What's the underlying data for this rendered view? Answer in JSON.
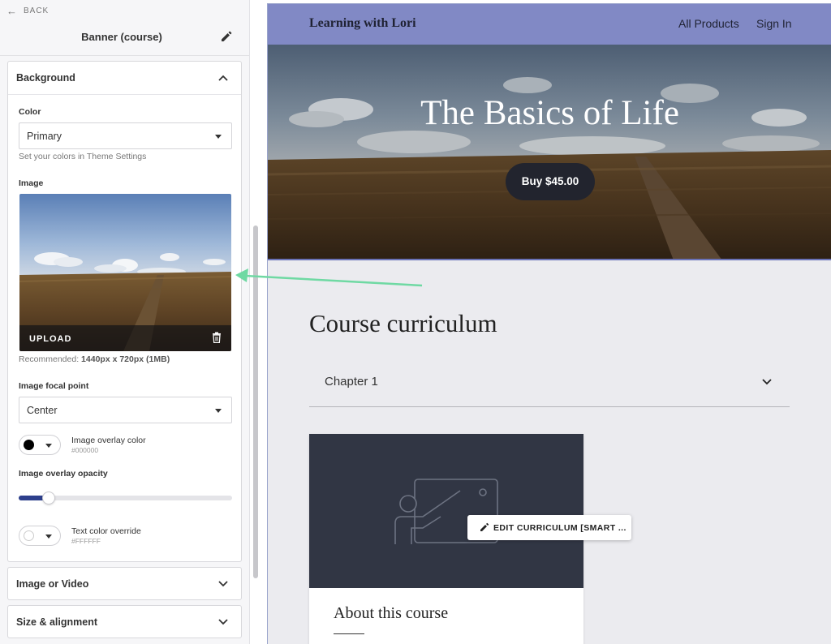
{
  "panel": {
    "back_label": "BACK",
    "title": "Banner (course)",
    "background": {
      "heading": "Background",
      "color_label": "Color",
      "color_value": "Primary",
      "color_hint": "Set your colors in Theme Settings",
      "image_label": "Image",
      "upload_label": "UPLOAD",
      "recommended_prefix": "Recommended:",
      "recommended_value": "1440px x 720px (1MB)",
      "focal_label": "Image focal point",
      "focal_value": "Center",
      "overlay_color_label": "Image overlay color",
      "overlay_color_hex": "#000000",
      "overlay_opacity_label": "Image overlay opacity",
      "overlay_opacity_fraction": 0.14,
      "text_color_label": "Text color override",
      "text_color_hex": "#FFFFFF"
    },
    "sections": [
      {
        "label": "Image or Video"
      },
      {
        "label": "Size & alignment"
      }
    ]
  },
  "site": {
    "brand": "Learning with Lori",
    "nav": [
      "All Products",
      "Sign In"
    ],
    "hero_title": "The Basics of Life",
    "buy_label": "Buy $45.00",
    "curriculum_title": "Course curriculum",
    "chapter_label": "Chapter 1",
    "edit_label": "EDIT CURRICULUM [SMART ...",
    "about_title": "About this course"
  },
  "colors": {
    "navbar": "#8189c5",
    "slider_fill": "#2d3f8c",
    "buy_button": "#22242e",
    "annotation_arrow": "#6fd9a3"
  }
}
